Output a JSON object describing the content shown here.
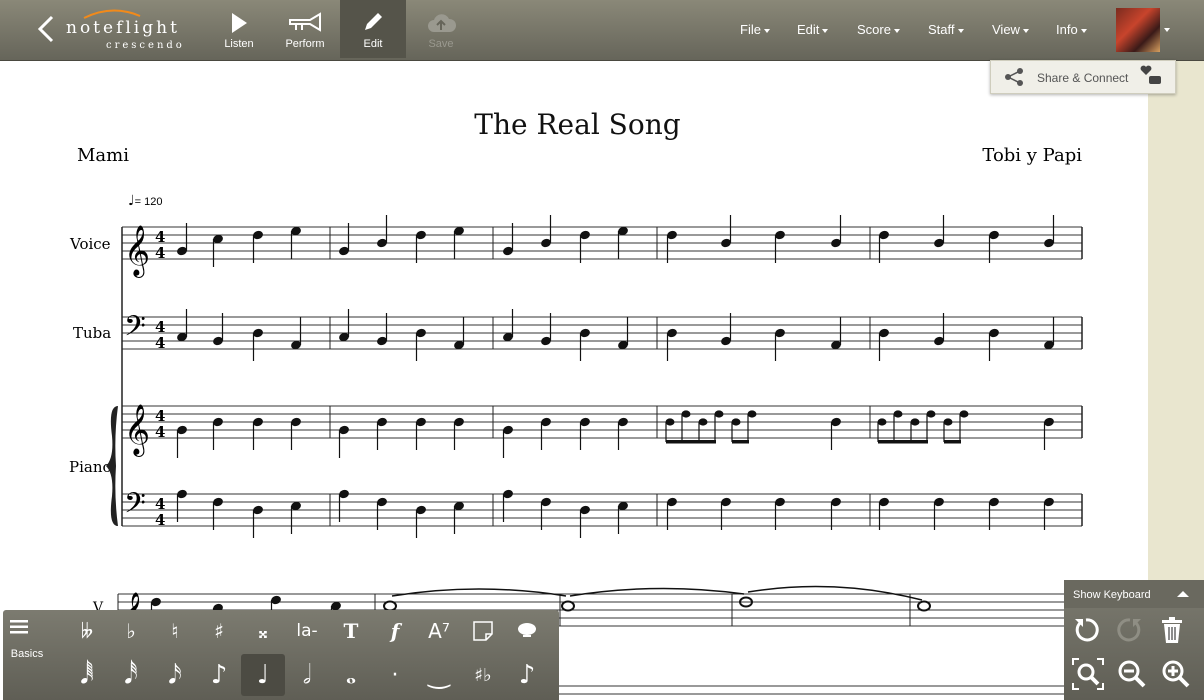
{
  "toolbar": {
    "logo_top": "noteflight",
    "logo_bottom": "crescendo",
    "buttons": [
      {
        "label": "Listen"
      },
      {
        "label": "Perform"
      },
      {
        "label": "Edit"
      },
      {
        "label": "Save"
      }
    ],
    "menus": [
      "File",
      "Edit",
      "Score",
      "Staff",
      "View",
      "Info"
    ]
  },
  "share": {
    "label": "Share & Connect"
  },
  "score": {
    "title": "The Real Song",
    "lyricist": "Mami",
    "composer": "Tobi y Papi",
    "tempo": "= 120",
    "parts": [
      "Voice",
      "Tuba",
      "Piano"
    ],
    "second_system_label": "V"
  },
  "palette": {
    "menu_label": "Basics",
    "row1": [
      "𝄫",
      "♭",
      "♮",
      "♯",
      "𝄪",
      "la-",
      "T",
      "f",
      "A⁷",
      "note-icon",
      "balloon-icon"
    ],
    "row2": [
      "64th",
      "32nd",
      "16th",
      "8th",
      "quarter",
      "half",
      "whole",
      "dot",
      "tie",
      "♯♭",
      "grace"
    ]
  },
  "keyboard_panel": {
    "label": "Show Keyboard"
  },
  "colors": {
    "toolbar": "#66655a",
    "sidebar": "#e9e6cf",
    "accent_logo": "#f28a1a"
  }
}
